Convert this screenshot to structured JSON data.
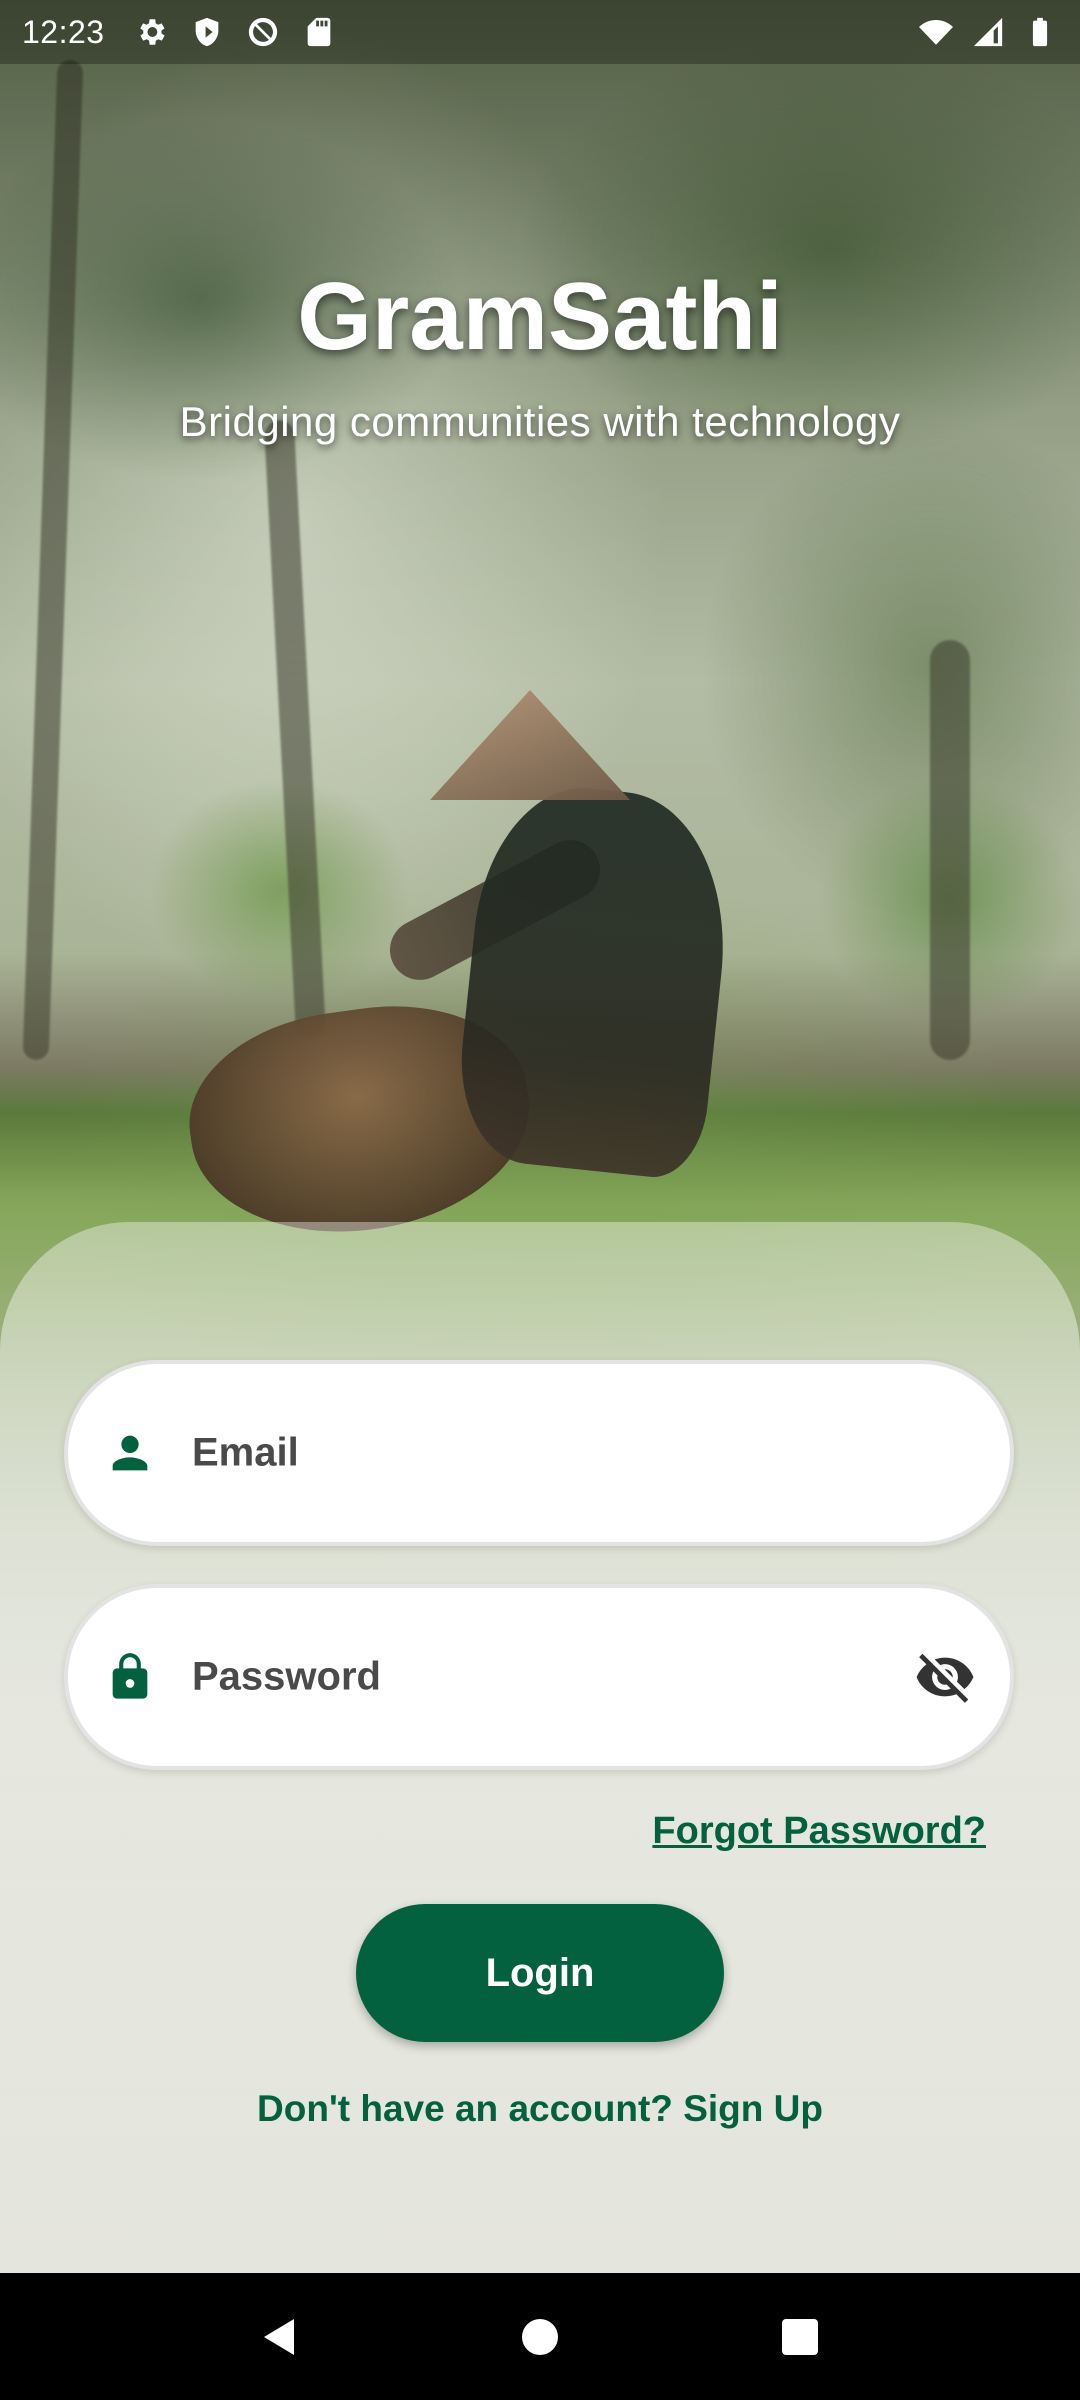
{
  "status_bar": {
    "time": "12:23",
    "left_icons": [
      "settings-icon",
      "shield-icon",
      "vpn-blocked-icon",
      "sd-card-icon"
    ],
    "right_icons": [
      "wifi-icon",
      "cellular-signal-icon",
      "battery-icon"
    ]
  },
  "header": {
    "title": "GramSathi",
    "tagline": "Bridging communities with technology"
  },
  "form": {
    "email": {
      "placeholder": "Email",
      "icon": "person-icon"
    },
    "password": {
      "placeholder": "Password",
      "icon": "lock-icon",
      "toggle_icon": "visibility-off-icon"
    },
    "forgot_password_label": "Forgot Password?",
    "login_label": "Login",
    "signup_prompt": "Don't have an account? ",
    "signup_link": "Sign Up"
  },
  "nav_bar": {
    "buttons": [
      "back-icon",
      "home-icon",
      "recents-icon"
    ]
  },
  "colors": {
    "accent": "#04613f",
    "field_background": "#ffffff",
    "text_dark": "#4a4a4a"
  }
}
